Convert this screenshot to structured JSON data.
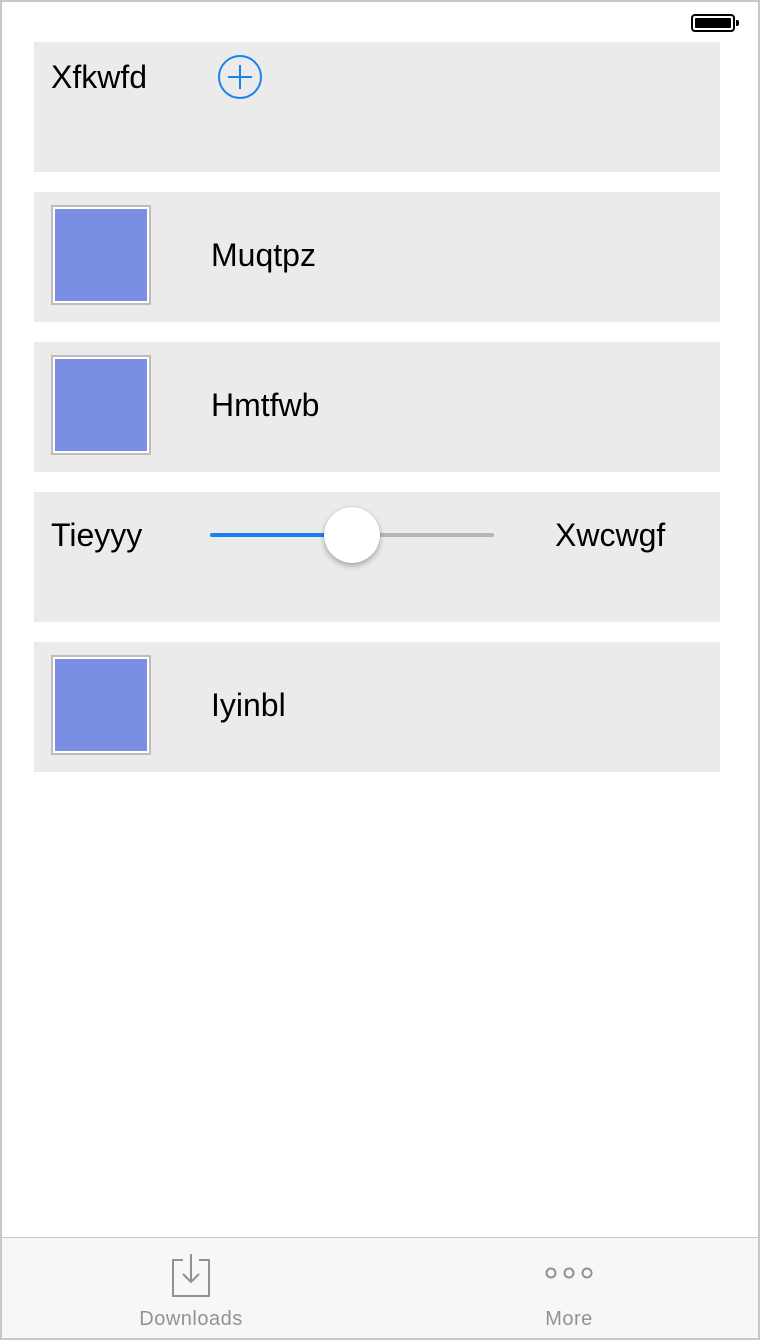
{
  "accent_color": "#1a82f0",
  "swatch_color": "#7a8fe4",
  "header_card": {
    "title": "Xfkwfd",
    "add_icon": "plus-circle-icon"
  },
  "rows": [
    {
      "label": "Muqtpz"
    },
    {
      "label": "Hmtfwb"
    }
  ],
  "slider_card": {
    "min_label": "Tieyyy",
    "max_label": "Xwcwgf",
    "value": 0.5
  },
  "last_row": {
    "label": "Iyinbl"
  },
  "tabbar": {
    "tabs": [
      {
        "label": "Downloads",
        "icon": "download-tray-icon"
      },
      {
        "label": "More",
        "icon": "more-dots-icon"
      }
    ]
  }
}
